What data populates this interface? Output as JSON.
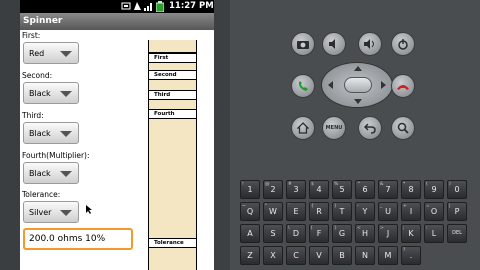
{
  "statusbar": {
    "time": "11:27 PM"
  },
  "app": {
    "title": "Spinner"
  },
  "fields": [
    {
      "label": "First:",
      "value": "Red"
    },
    {
      "label": "Second:",
      "value": "Black"
    },
    {
      "label": "Third:",
      "value": "Black"
    },
    {
      "label": "Fourth(Multiplier):",
      "value": "Black"
    },
    {
      "label": "Tolerance:",
      "value": "Silver"
    }
  ],
  "result": "200.0 ohms 10%",
  "resistor_bands": [
    "First",
    "Second",
    "Third",
    "Fourth",
    "Tolerance"
  ],
  "emulator": {
    "keyboard_rows": [
      [
        "1",
        "2",
        "3",
        "4",
        "5",
        "6",
        "7",
        "8",
        "9",
        "0"
      ],
      [
        "Q",
        "W",
        "E",
        "R",
        "T",
        "Y",
        "U",
        "I",
        "O",
        "P"
      ],
      [
        "A",
        "S",
        "D",
        "F",
        "G",
        "H",
        "J",
        "K",
        "L",
        "DEL"
      ],
      [
        "Z",
        "X",
        "C",
        "V",
        "B",
        "N",
        "M",
        "."
      ]
    ],
    "keyboard_alt": [
      [
        "!",
        "@",
        "#",
        "$",
        "%",
        "^",
        "&",
        "*",
        "(",
        ")"
      ],
      [
        "~",
        "\"",
        "`",
        "{",
        "}",
        "-",
        "_",
        "+",
        "=",
        "|"
      ],
      [
        "",
        "",
        "\\",
        "[",
        "]",
        "<",
        ">",
        ";",
        ":",
        ""
      ],
      [
        "",
        "",
        "",
        "",
        "",
        "",
        "",
        "?"
      ]
    ],
    "menu_label": "MENU"
  }
}
